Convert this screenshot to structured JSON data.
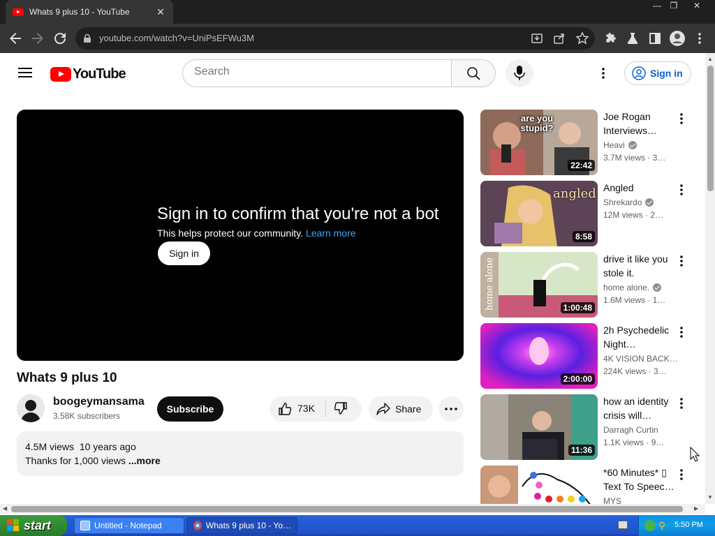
{
  "browser": {
    "tab_title": "Whats 9 plus 10 - YouTube",
    "url": "youtube.com/watch?v=UniPsEFWu3M"
  },
  "header": {
    "logo_text": "YouTube",
    "search_placeholder": "Search",
    "sign_in_label": "Sign in"
  },
  "player": {
    "heading": "Sign in to confirm that you're not a bot",
    "subtext": "This helps protect our community.",
    "learn_more": "Learn more",
    "sign_in_button": "Sign in"
  },
  "video": {
    "title": "Whats 9 plus 10",
    "channel": "boogeymansama",
    "subscribers": "3.58K subscribers",
    "subscribe_label": "Subscribe",
    "likes": "73K",
    "share_label": "Share",
    "views": "4.5M views",
    "age": "10 years ago",
    "description": "Thanks for 1,000 views",
    "more_label": "...more"
  },
  "recommendations": [
    {
      "title": "Joe Rogan Interviews…",
      "channel": "Heavi",
      "verified": true,
      "views": "3.7M views · 3…",
      "duration": "22:42",
      "thumb_text": "are you stupid?"
    },
    {
      "title": "Angled",
      "channel": "Shrekardo",
      "verified": true,
      "views": "12M views · 2…",
      "duration": "8:58",
      "thumb_text": "angled"
    },
    {
      "title": "drive it like you stole it.",
      "channel": "home alone.",
      "verified": true,
      "views": "1.6M views · 1…",
      "duration": "1:00:48",
      "thumb_text": "home alone"
    },
    {
      "title": "2h Psychedelic Night…",
      "channel": "4K VISION BACK…",
      "verified": false,
      "views": "224K views · 3…",
      "duration": "2:00:00",
      "thumb_text": ""
    },
    {
      "title": "how an identity crisis will…",
      "channel": "Darragh Curtin",
      "verified": false,
      "views": "1.1K views · 9…",
      "duration": "11:36",
      "thumb_text": ""
    },
    {
      "title": "*60 Minutes* ▯ Text To Speec…",
      "channel": "MYS",
      "verified": false,
      "views": "",
      "duration": "",
      "thumb_text": ""
    }
  ],
  "taskbar": {
    "start_label": "start",
    "tasks": [
      "Untitled - Notepad",
      "Whats 9 plus 10 - Yo…"
    ],
    "clock": "5:50 PM"
  },
  "colors": {
    "youtube_red": "#ff0000",
    "link_blue": "#065fd4",
    "player_link": "#3ea6ff"
  }
}
